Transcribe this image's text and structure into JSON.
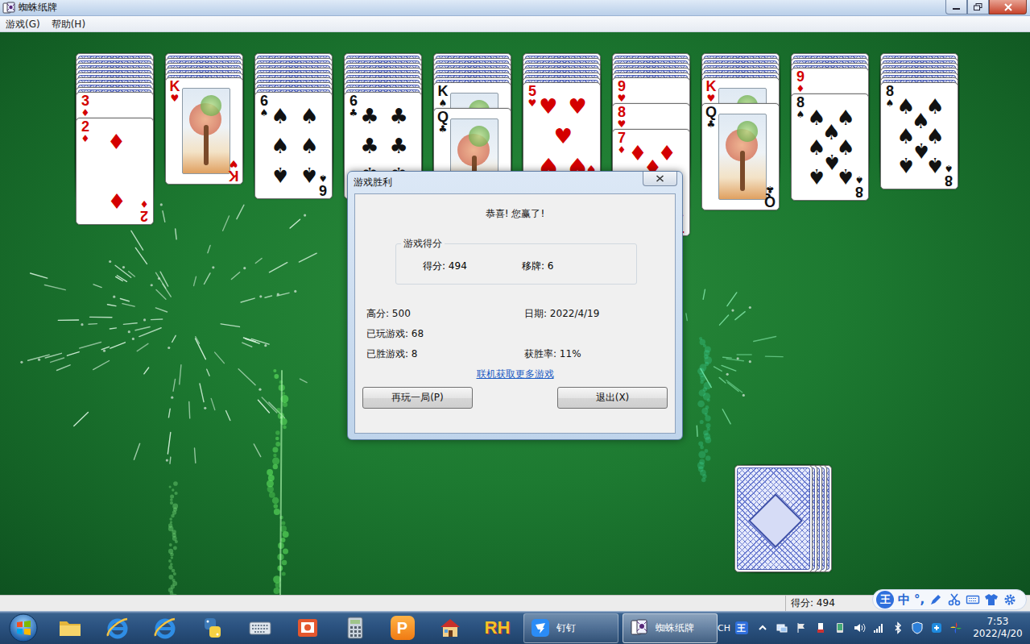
{
  "window": {
    "title": "蜘蛛纸牌"
  },
  "menu": [
    {
      "label": "游戏(G)"
    },
    {
      "label": "帮助(H)"
    }
  ],
  "tableau": [
    {
      "hidden": 8,
      "cards": [
        {
          "rank": "3",
          "suit": "♦",
          "color": "#d40000",
          "kind": "pip"
        },
        {
          "rank": "2",
          "suit": "♦",
          "color": "#d40000",
          "kind": "pip"
        }
      ]
    },
    {
      "hidden": 5,
      "cards": [
        {
          "rank": "K",
          "suit": "♥",
          "color": "#d40000",
          "kind": "court"
        }
      ]
    },
    {
      "hidden": 8,
      "cards": [
        {
          "rank": "6",
          "suit": "♠",
          "color": "#111111",
          "kind": "pip"
        }
      ]
    },
    {
      "hidden": 8,
      "cards": [
        {
          "rank": "6",
          "suit": "♣",
          "color": "#111111",
          "kind": "pip"
        }
      ]
    },
    {
      "hidden": 6,
      "cards": [
        {
          "rank": "K",
          "suit": "♠",
          "color": "#111111",
          "kind": "court"
        },
        {
          "rank": "Q",
          "suit": "♣",
          "color": "#111111",
          "kind": "court"
        }
      ]
    },
    {
      "hidden": 6,
      "cards": [
        {
          "rank": "5",
          "suit": "♥",
          "color": "#d40000",
          "kind": "pip"
        }
      ]
    },
    {
      "hidden": 5,
      "cards": [
        {
          "rank": "9",
          "suit": "♥",
          "color": "#d40000",
          "kind": "pip"
        },
        {
          "rank": "8",
          "suit": "♥",
          "color": "#d40000",
          "kind": "pip"
        },
        {
          "rank": "7",
          "suit": "♦",
          "color": "#d40000",
          "kind": "pip"
        }
      ]
    },
    {
      "hidden": 5,
      "cards": [
        {
          "rank": "K",
          "suit": "♥",
          "color": "#d40000",
          "kind": "court"
        },
        {
          "rank": "Q",
          "suit": "♣",
          "color": "#111111",
          "kind": "court"
        }
      ]
    },
    {
      "hidden": 3,
      "cards": [
        {
          "rank": "9",
          "suit": "♦",
          "color": "#d40000",
          "kind": "pip"
        },
        {
          "rank": "8",
          "suit": "♠",
          "color": "#111111",
          "kind": "pip"
        }
      ]
    },
    {
      "hidden": 6,
      "cards": [
        {
          "rank": "8",
          "suit": "♠",
          "color": "#111111",
          "kind": "pip"
        }
      ]
    }
  ],
  "stock": {
    "piles": 5
  },
  "dialog": {
    "title": "游戏胜利",
    "message": "恭喜! 您赢了!",
    "group_title": "游戏得分",
    "score": "得分: 494",
    "moves": "移牌: 6",
    "high_score": "高分: 500",
    "date": "日期: 2022/4/19",
    "played": "已玩游戏: 68",
    "won": "已胜游戏: 8",
    "win_rate": "获胜率: 11%",
    "link": "联机获取更多游戏",
    "buttons": [
      {
        "label": "再玩一局(P)"
      },
      {
        "label": "退出(X)"
      }
    ]
  },
  "status_bar": {
    "score": "得分: 494"
  },
  "ime_bar": {
    "items": [
      {
        "kind": "logo",
        "text": "王"
      },
      {
        "kind": "text",
        "text": "中"
      },
      {
        "kind": "text",
        "text": "°,"
      },
      {
        "kind": "pen"
      },
      {
        "kind": "scissors"
      },
      {
        "kind": "keyboard"
      },
      {
        "kind": "shirt"
      },
      {
        "kind": "gear"
      }
    ]
  },
  "taskbar": {
    "pinned": [
      {
        "kind": "folder"
      },
      {
        "kind": "ie"
      },
      {
        "kind": "ie"
      },
      {
        "kind": "python"
      },
      {
        "kind": "keyboard"
      },
      {
        "kind": "slides"
      },
      {
        "kind": "calculator"
      },
      {
        "kind": "wps",
        "text": "P"
      },
      {
        "kind": "house"
      },
      {
        "kind": "rh",
        "text": "RH"
      }
    ],
    "tasks": [
      {
        "label": "钉钉",
        "kind": "dingtalk",
        "selected": false
      },
      {
        "label": "蜘蛛纸牌",
        "kind": "spider",
        "selected": true
      }
    ],
    "tray": {
      "language": "CH",
      "ime": "王",
      "time": "7:53",
      "date": "2022/4/20"
    }
  }
}
